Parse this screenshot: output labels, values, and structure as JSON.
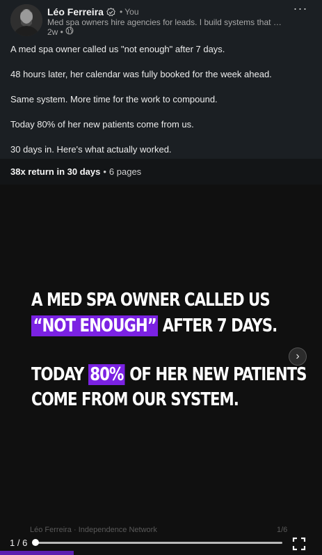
{
  "post": {
    "author_name": "Léo Ferreira",
    "you_label": "• You",
    "headline": "Med spa owners hire agencies for leads. I build systems that book pa...",
    "time": "2w •",
    "more_label": "···",
    "paragraphs": [
      "A med spa owner called us \"not enough\" after 7 days.",
      "48 hours later, her calendar was fully booked for the week ahead.",
      "Same system. More time for the work to compound.",
      "Today 80% of her new patients come from us.",
      "30 days in. Here's what actually worked."
    ]
  },
  "document": {
    "title": "38x return in 30 days",
    "separator": "•",
    "pages": "6 pages"
  },
  "slide": {
    "line1": "A MED SPA OWNER CALLED US",
    "line2_highlight": "“NOT ENOUGH”",
    "line2_rest": " AFTER 7 DAYS.",
    "line3_pre": "TODAY ",
    "line3_highlight": "80%",
    "line3_rest": " OF HER NEW PATIENTS",
    "line4": "COME FROM OUR SYSTEM.",
    "footer_author": "Léo Ferreira · Independence Network",
    "footer_page": "1/6",
    "next_label": "›",
    "highlight_color": "#7b22e3"
  },
  "controls": {
    "counter": "1 / 6",
    "progress_fraction": 0.0
  }
}
